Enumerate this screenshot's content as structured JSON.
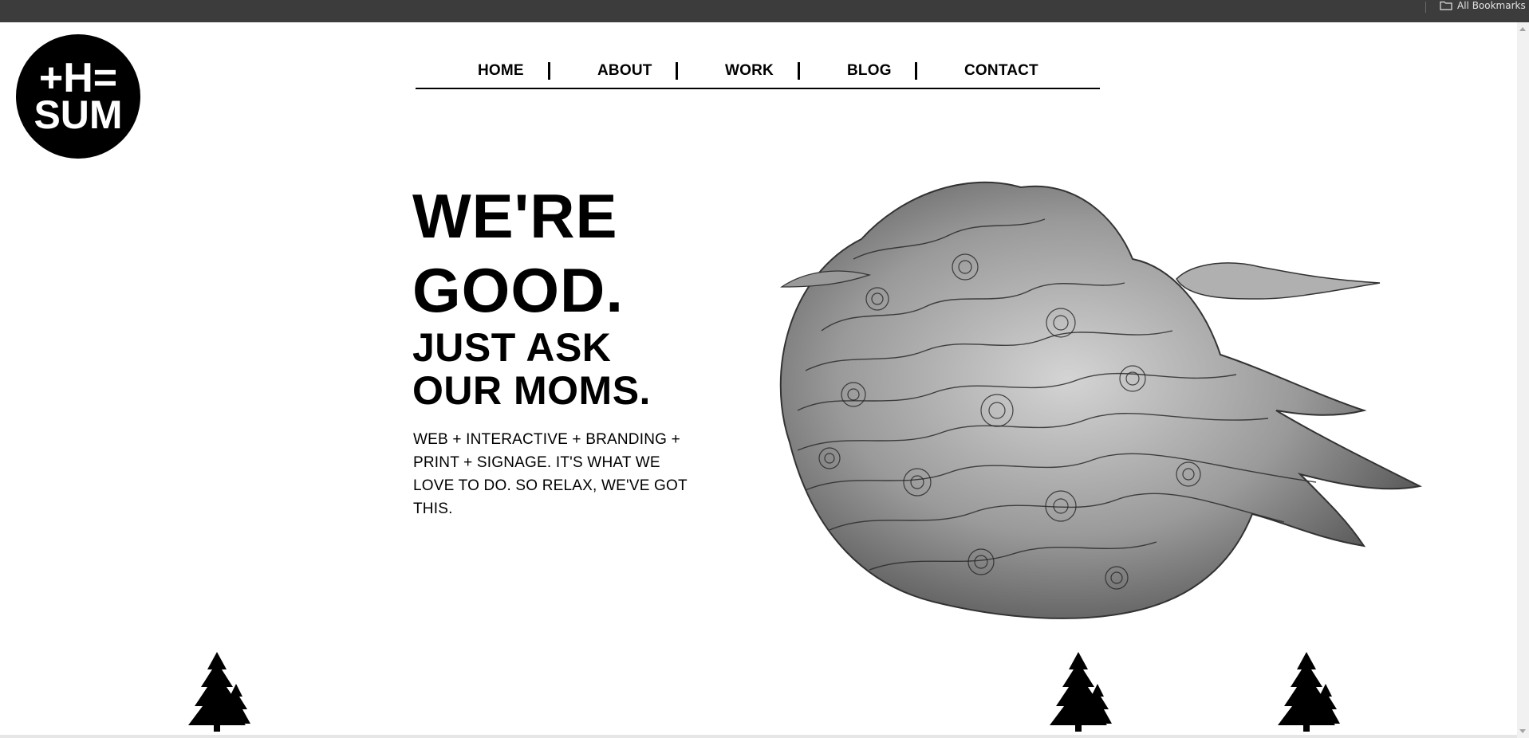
{
  "browser": {
    "bookmarks_label": "All Bookmarks"
  },
  "logo": {
    "line1": "+H=",
    "line2": "SUM"
  },
  "nav": {
    "items": [
      {
        "label": "HOME"
      },
      {
        "label": "ABOUT"
      },
      {
        "label": "WORK"
      },
      {
        "label": "BLOG"
      },
      {
        "label": "CONTACT"
      }
    ]
  },
  "hero": {
    "line1": "WE'RE",
    "line2": "GOOD.",
    "line3": "JUST ASK",
    "line4": "OUR MOMS.",
    "tagline": "WEB + INTERACTIVE + BRANDING + PRINT + SIGNAGE. IT'S WHAT WE LOVE TO DO. SO RELAX, WE'VE GOT THIS."
  },
  "colors": {
    "text": "#000000",
    "background": "#ffffff",
    "browser_bar": "#3c3c3c"
  },
  "icons": [
    "folder-icon",
    "logo-badge",
    "hair-cloud-illustration",
    "pine-tree-icon"
  ]
}
